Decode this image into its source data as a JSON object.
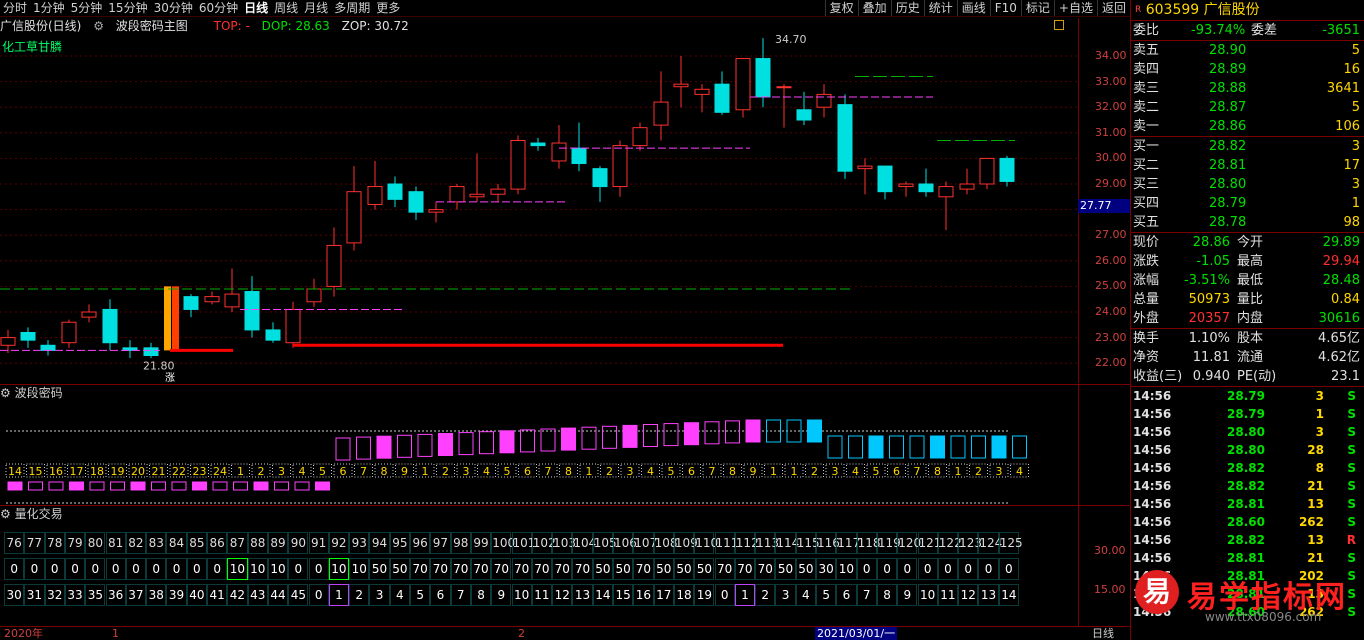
{
  "periods": [
    "分时",
    "1分钟",
    "5分钟",
    "15分钟",
    "30分钟",
    "60分钟",
    "日线",
    "周线",
    "月线",
    "多周期",
    "更多"
  ],
  "selected_period": "日线",
  "tools": [
    "复权",
    "叠加",
    "历史",
    "统计",
    "画线",
    "F10",
    "标记",
    "+自选",
    "返回"
  ],
  "main": {
    "name": "广信股份(日线)",
    "indicator": "波段密码主图",
    "top": "TOP: -",
    "dop": "DOP: 28.63",
    "zop": "ZOP: 30.72",
    "sector": "化工草甘膦",
    "high_label": "34.70",
    "low_label": "21.80",
    "zhang": "涨"
  },
  "yaxis": [
    "34.00",
    "33.00",
    "32.00",
    "31.00",
    "30.00",
    "29.00",
    "28.00",
    "27.00",
    "26.00",
    "25.00",
    "24.00",
    "23.00",
    "22.00"
  ],
  "current_price_tag": "27.77",
  "ind1": {
    "name": "波段密码",
    "seq": [
      "14",
      "15",
      "16",
      "17",
      "18",
      "19",
      "20",
      "21",
      "22",
      "23",
      "24",
      "1",
      "2",
      "3",
      "4",
      "5",
      "6",
      "7",
      "8",
      "9",
      "1",
      "2",
      "3",
      "4",
      "5",
      "6",
      "7",
      "8",
      "1",
      "2",
      "3",
      "4",
      "5",
      "6",
      "7",
      "8",
      "9",
      "1",
      "1",
      "2",
      "3",
      "4",
      "5",
      "6",
      "7",
      "8",
      "1",
      "2",
      "3",
      "4"
    ]
  },
  "ind2": {
    "name": "量化交易",
    "axis": [
      "30.00",
      "15.00"
    ],
    "row1": [
      "76",
      "77",
      "78",
      "79",
      "80",
      "81",
      "82",
      "83",
      "84",
      "85",
      "86",
      "87",
      "88",
      "89",
      "90",
      "91",
      "92",
      "93",
      "94",
      "95",
      "96",
      "97",
      "98",
      "99",
      "100",
      "101",
      "102",
      "103",
      "104",
      "105",
      "106",
      "107",
      "108",
      "109",
      "110",
      "111",
      "112",
      "113",
      "114",
      "115",
      "116",
      "117",
      "118",
      "119",
      "120",
      "121",
      "122",
      "123",
      "124",
      "125"
    ],
    "row2": [
      "0",
      "0",
      "0",
      "0",
      "0",
      "0",
      "0",
      "0",
      "0",
      "0",
      "0",
      "10",
      "10",
      "10",
      "0",
      "0",
      "10",
      "10",
      "50",
      "50",
      "70",
      "70",
      "70",
      "70",
      "70",
      "70",
      "70",
      "70",
      "70",
      "50",
      "50",
      "70",
      "50",
      "50",
      "50",
      "70",
      "70",
      "70",
      "50",
      "50",
      "30",
      "10",
      "0",
      "0",
      "0",
      "0",
      "0",
      "0",
      "0",
      "0"
    ],
    "row3": [
      "30",
      "31",
      "32",
      "33",
      "35",
      "36",
      "37",
      "38",
      "39",
      "40",
      "41",
      "42",
      "43",
      "44",
      "45",
      "0",
      "1",
      "2",
      "3",
      "4",
      "5",
      "6",
      "7",
      "8",
      "9",
      "10",
      "11",
      "12",
      "13",
      "14",
      "15",
      "16",
      "17",
      "18",
      "19",
      "0",
      "1",
      "2",
      "3",
      "4",
      "5",
      "6",
      "7",
      "8",
      "9",
      "10",
      "11",
      "12",
      "13",
      "14"
    ]
  },
  "bottom": {
    "year": "2020年",
    "m1": "1",
    "m2": "2",
    "date": "2021/03/01/一",
    "period": "日线"
  },
  "stock": {
    "code": "603599",
    "name": "广信股份",
    "flag": "R"
  },
  "weibi": {
    "label1": "委比",
    "val1": "-93.74%",
    "label2": "委差",
    "val2": "-3651"
  },
  "asks": [
    {
      "l": "卖五",
      "p": "28.90",
      "v": "5"
    },
    {
      "l": "卖四",
      "p": "28.89",
      "v": "16"
    },
    {
      "l": "卖三",
      "p": "28.88",
      "v": "3641"
    },
    {
      "l": "卖二",
      "p": "28.87",
      "v": "5"
    },
    {
      "l": "卖一",
      "p": "28.86",
      "v": "106"
    }
  ],
  "bids": [
    {
      "l": "买一",
      "p": "28.82",
      "v": "3"
    },
    {
      "l": "买二",
      "p": "28.81",
      "v": "17"
    },
    {
      "l": "买三",
      "p": "28.80",
      "v": "3"
    },
    {
      "l": "买四",
      "p": "28.79",
      "v": "1"
    },
    {
      "l": "买五",
      "p": "28.78",
      "v": "98"
    }
  ],
  "quote": [
    {
      "l1": "现价",
      "v1": "28.86",
      "c1": "g",
      "l2": "今开",
      "v2": "29.89",
      "c2": "g"
    },
    {
      "l1": "涨跌",
      "v1": "-1.05",
      "c1": "g",
      "l2": "最高",
      "v2": "29.94",
      "c2": "r"
    },
    {
      "l1": "涨幅",
      "v1": "-3.51%",
      "c1": "g",
      "l2": "最低",
      "v2": "28.48",
      "c2": "g"
    },
    {
      "l1": "总量",
      "v1": "50973",
      "c1": "y",
      "l2": "量比",
      "v2": "0.84",
      "c2": "y"
    },
    {
      "l1": "外盘",
      "v1": "20357",
      "c1": "r",
      "l2": "内盘",
      "v2": "30616",
      "c2": "g"
    }
  ],
  "fund": [
    {
      "l1": "换手",
      "v1": "1.10%",
      "l2": "股本",
      "v2": "4.65亿"
    },
    {
      "l1": "净资",
      "v1": "11.81",
      "l2": "流通",
      "v2": "4.62亿"
    },
    {
      "l1": "收益(三)",
      "v1": "0.940",
      "l2": "PE(动)",
      "v2": "23.1"
    }
  ],
  "ticks": [
    {
      "t": "14:56",
      "p": "28.79",
      "v": "3",
      "s": "S"
    },
    {
      "t": "14:56",
      "p": "28.79",
      "v": "1",
      "s": "S"
    },
    {
      "t": "14:56",
      "p": "28.80",
      "v": "3",
      "s": "S"
    },
    {
      "t": "14:56",
      "p": "28.80",
      "v": "28",
      "s": "S"
    },
    {
      "t": "14:56",
      "p": "28.82",
      "v": "8",
      "s": "S"
    },
    {
      "t": "14:56",
      "p": "28.82",
      "v": "21",
      "s": "S"
    },
    {
      "t": "14:56",
      "p": "28.81",
      "v": "13",
      "s": "S"
    },
    {
      "t": "14:56",
      "p": "28.60",
      "v": "262",
      "s": "S"
    },
    {
      "t": "14:56",
      "p": "28.82",
      "v": "13",
      "s": "R"
    },
    {
      "t": "14:56",
      "p": "28.81",
      "v": "21",
      "s": "S"
    },
    {
      "t": "14:56",
      "p": "28.81",
      "v": "202",
      "s": "S"
    },
    {
      "t": "14:56",
      "p": "28.81",
      "v": "13",
      "s": "S"
    },
    {
      "t": "14:56",
      "p": "28.60",
      "v": "262",
      "s": "S"
    }
  ],
  "watermark": {
    "logo": "易",
    "text": "易学指标网",
    "url": "www.ttx08096.com"
  },
  "colors": {
    "up": "#ff3030",
    "down": "#00e0e0",
    "bg": "#000000",
    "grid": "#7a0000"
  }
}
